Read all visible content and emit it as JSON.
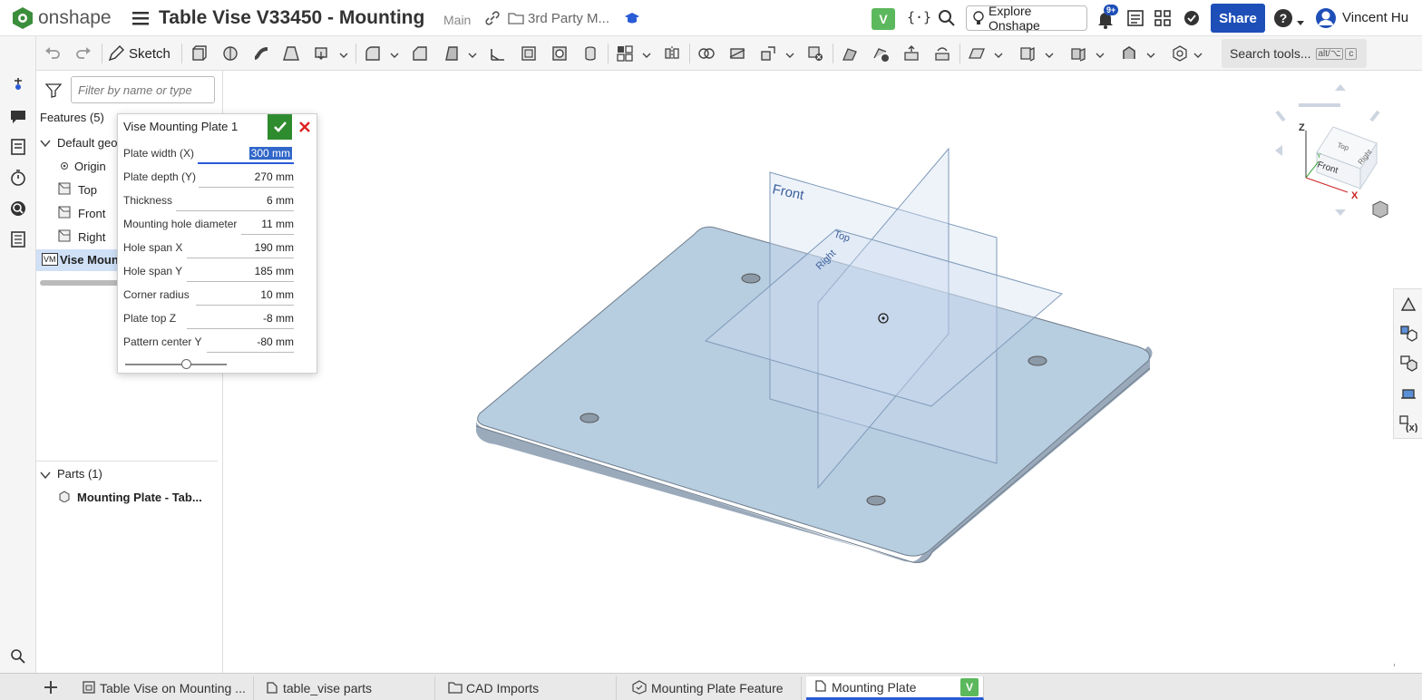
{
  "header": {
    "logo_text": "onshape",
    "doc_title": "Table Vise V33450 - Mounting",
    "branch": "Main",
    "folder": "3rd Party M...",
    "version_badge": "V",
    "explore_label": "Explore Onshape",
    "notif_count": "9+",
    "share_label": "Share",
    "help_label": "?",
    "user_name": "Vincent Hu"
  },
  "toolbar": {
    "sketch_label": "Sketch",
    "search_label": "Search tools...",
    "shortcut_1": "alt/⌥",
    "shortcut_2": "c"
  },
  "panel": {
    "filter_placeholder": "Filter by name or type",
    "features_header": "Features (5)",
    "default_geo": "Default geo",
    "items": [
      "Origin",
      "Top",
      "Front",
      "Right"
    ],
    "feature_badge": "VM",
    "feature_name": "Vise Moun",
    "parts_header": "Parts (1)",
    "part_name": "Mounting Plate - Tab..."
  },
  "dialog": {
    "title": "Vise Mounting Plate 1",
    "params": [
      {
        "label": "Plate width (X)",
        "value": "300 mm"
      },
      {
        "label": "Plate depth (Y)",
        "value": "270 mm"
      },
      {
        "label": "Thickness",
        "value": "6 mm"
      },
      {
        "label": "Mounting hole diameter",
        "value": "11 mm"
      },
      {
        "label": "Hole span X",
        "value": "190 mm"
      },
      {
        "label": "Hole span Y",
        "value": "185 mm"
      },
      {
        "label": "Corner radius",
        "value": "10 mm"
      },
      {
        "label": "Plate top Z",
        "value": "-8 mm"
      },
      {
        "label": "Pattern center Y",
        "value": "-80 mm"
      }
    ],
    "slider_value": 0.6
  },
  "viewport": {
    "plane_front": "Front",
    "plane_top": "Top",
    "plane_right": "Right",
    "cube_top": "Top",
    "cube_front": "Front",
    "cube_right": "Right",
    "axis_z": "Z",
    "axis_x": "X",
    "axis_y": "Y",
    "plate_color": "#b7cde0"
  },
  "tabs": [
    {
      "label": "Table Vise on Mounting ...",
      "icon": "assembly-icon"
    },
    {
      "label": "table_vise parts",
      "icon": "part-studio-icon"
    },
    {
      "label": "CAD Imports",
      "icon": "folder-icon"
    },
    {
      "label": "Mounting Plate Feature",
      "icon": "feature-studio-icon"
    },
    {
      "label": "Mounting Plate",
      "icon": "part-studio-icon",
      "badge": "V"
    }
  ],
  "colors": {
    "brand_green": "#3b8e3b",
    "accent_blue": "#2a5bd7",
    "share_blue": "#1e4fb8",
    "confirm_green": "#2e8b2e",
    "cancel_red": "#d22"
  }
}
